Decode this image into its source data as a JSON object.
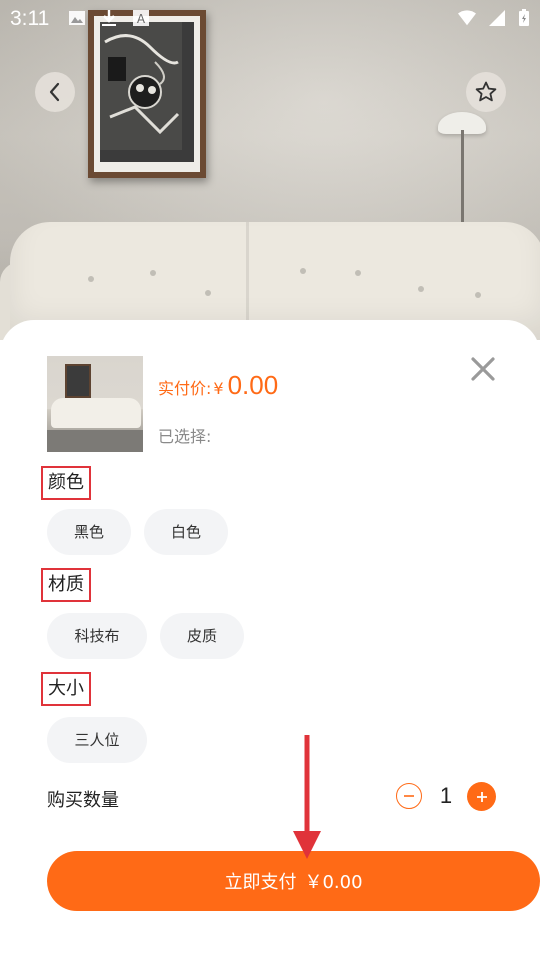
{
  "status_bar": {
    "time": "3:11",
    "left_icons": [
      "image-icon",
      "download-icon",
      "text-a-icon"
    ],
    "right_icons": [
      "wifi-icon",
      "signal-icon",
      "battery-icon"
    ]
  },
  "header": {
    "back_icon": "chevron-left-icon",
    "favorite_icon": "star-outline-icon"
  },
  "sheet": {
    "price_label": "实付价:",
    "currency": "¥",
    "price_value": "0.00",
    "selected_label": "已选择:",
    "close_icon": "close-icon",
    "groups": [
      {
        "title": "颜色",
        "options": [
          "黑色",
          "白色"
        ]
      },
      {
        "title": "材质",
        "options": [
          "科技布",
          "皮质"
        ]
      },
      {
        "title": "大小",
        "options": [
          "三人位"
        ]
      }
    ],
    "quantity_label": "购买数量",
    "quantity_value": "1",
    "pay_button_label": "立即支付",
    "pay_button_amount": "￥0.00"
  },
  "colors": {
    "accent": "#ff6a16",
    "highlight_box": "#e0333a",
    "chip_bg": "#f3f4f6",
    "annotation_arrow": "#e0333a"
  }
}
